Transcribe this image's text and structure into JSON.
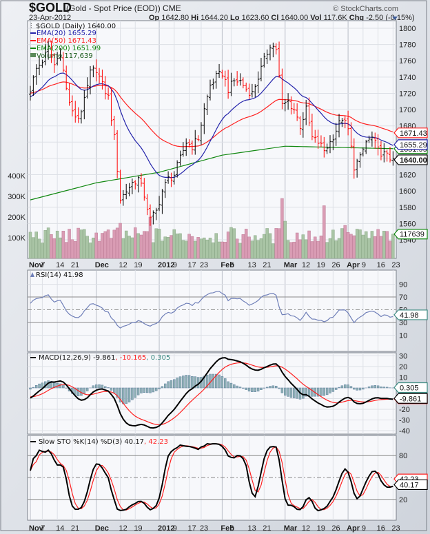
{
  "header": {
    "symbol": "$GOLD",
    "description": "(Gold - Spot Price (EOD)) CME",
    "copyright": "© StockCharts.com",
    "date": "23-Apr-2012",
    "quote": [
      {
        "label": "Op",
        "value": "1642.80"
      },
      {
        "label": "Hi",
        "value": "1644.20"
      },
      {
        "label": "Lo",
        "value": "1623.60"
      },
      {
        "label": "Cl",
        "value": "1640.00"
      },
      {
        "label": "Vol",
        "value": "117.6K"
      },
      {
        "label": "Chg",
        "value": "-2.50 (-0.15%)"
      }
    ]
  },
  "legend": {
    "price": "$GOLD (Daily) 1640.00",
    "ema20": "EMA(20) 1655.29",
    "ema50": "EMA(50) 1671.43",
    "ema200": "EMA(200) 1651.99",
    "volume": "Volume 117,639",
    "rsi": "RSI(14) 41.98",
    "macd_label": "MACD(12,26,9) -9.861",
    "macd_signal": ", -10.165",
    "macd_hist": ", 0.305",
    "sto_label": "Slow STO %K(14) %D(3) 40.17",
    "sto_d": ", 42.23"
  },
  "tags": {
    "ema50": "1671.43",
    "ema20": "1655.29",
    "ema200": "1651.99",
    "close": "1640.00",
    "volume": "117639",
    "rsi": "41.98",
    "macd_hist": "0.305",
    "macd_signal": "-10.165",
    "macd": "-9.861",
    "sto_d": "42.23",
    "sto_k": "40.17"
  },
  "colors": {
    "up": "#000000",
    "down": "#ff0000",
    "ema20": "#2222aa",
    "ema50": "#ff2020",
    "ema200": "#118811",
    "vol_up": "#a9c4a5",
    "vol_down": "#d99cb4",
    "rsi": "#6f7fb8",
    "hist": "#8fb0b4"
  },
  "chart_data": {
    "type": "line",
    "title": "$GOLD (Gold - Spot Price (EOD)) CME",
    "x_ticks": [
      {
        "i": 0,
        "label": "Nov",
        "bold": true
      },
      {
        "i": 4,
        "label": "7"
      },
      {
        "i": 9,
        "label": "14"
      },
      {
        "i": 14,
        "label": "21"
      },
      {
        "i": 22,
        "label": "Dec",
        "bold": true
      },
      {
        "i": 30,
        "label": "12"
      },
      {
        "i": 35,
        "label": "19"
      },
      {
        "i": 43,
        "label": "2012",
        "bold": true
      },
      {
        "i": 48,
        "label": "9"
      },
      {
        "i": 53,
        "label": "17"
      },
      {
        "i": 57,
        "label": "23"
      },
      {
        "i": 64,
        "label": "Feb",
        "bold": true
      },
      {
        "i": 67,
        "label": "6"
      },
      {
        "i": 73,
        "label": "13"
      },
      {
        "i": 78,
        "label": "21"
      },
      {
        "i": 85,
        "label": "Mar",
        "bold": true
      },
      {
        "i": 91,
        "label": "12"
      },
      {
        "i": 96,
        "label": "19"
      },
      {
        "i": 101,
        "label": "26"
      },
      {
        "i": 106,
        "label": "Apr",
        "bold": true
      },
      {
        "i": 111,
        "label": "9"
      },
      {
        "i": 116,
        "label": "16"
      },
      {
        "i": 121,
        "label": "23"
      }
    ],
    "price_axis": {
      "ticks": [
        1540,
        1560,
        1580,
        1600,
        1620,
        1640,
        1660,
        1680,
        1700,
        1720,
        1740,
        1760,
        1780,
        1800
      ],
      "range": [
        1540,
        1800
      ]
    },
    "volume_axis": {
      "ticks": [
        100,
        200,
        300,
        400
      ],
      "labels": [
        "100K",
        "200K",
        "300K",
        "400K"
      ]
    },
    "close_keypoints": [
      [
        0,
        1725
      ],
      [
        2,
        1750
      ],
      [
        4,
        1760
      ],
      [
        6,
        1775
      ],
      [
        8,
        1755
      ],
      [
        10,
        1770
      ],
      [
        12,
        1725
      ],
      [
        14,
        1695
      ],
      [
        16,
        1690
      ],
      [
        18,
        1710
      ],
      [
        20,
        1745
      ],
      [
        22,
        1750
      ],
      [
        24,
        1730
      ],
      [
        26,
        1715
      ],
      [
        28,
        1665
      ],
      [
        30,
        1590
      ],
      [
        32,
        1600
      ],
      [
        34,
        1610
      ],
      [
        36,
        1615
      ],
      [
        38,
        1595
      ],
      [
        40,
        1565
      ],
      [
        42,
        1575
      ],
      [
        44,
        1600
      ],
      [
        46,
        1615
      ],
      [
        48,
        1620
      ],
      [
        50,
        1640
      ],
      [
        52,
        1660
      ],
      [
        54,
        1655
      ],
      [
        56,
        1665
      ],
      [
        58,
        1700
      ],
      [
        60,
        1730
      ],
      [
        62,
        1740
      ],
      [
        64,
        1745
      ],
      [
        66,
        1725
      ],
      [
        68,
        1735
      ],
      [
        70,
        1735
      ],
      [
        72,
        1725
      ],
      [
        74,
        1720
      ],
      [
        76,
        1740
      ],
      [
        78,
        1760
      ],
      [
        80,
        1780
      ],
      [
        82,
        1775
      ],
      [
        84,
        1705
      ],
      [
        86,
        1710
      ],
      [
        88,
        1700
      ],
      [
        90,
        1680
      ],
      [
        92,
        1700
      ],
      [
        94,
        1665
      ],
      [
        96,
        1660
      ],
      [
        98,
        1650
      ],
      [
        100,
        1660
      ],
      [
        102,
        1675
      ],
      [
        104,
        1690
      ],
      [
        106,
        1675
      ],
      [
        108,
        1630
      ],
      [
        110,
        1640
      ],
      [
        112,
        1660
      ],
      [
        114,
        1665
      ],
      [
        116,
        1650
      ],
      [
        118,
        1645
      ],
      [
        120,
        1640
      ],
      [
        121,
        1640
      ]
    ],
    "ema200_keypoints": [
      [
        0,
        1589
      ],
      [
        22,
        1610
      ],
      [
        43,
        1623
      ],
      [
        64,
        1644
      ],
      [
        85,
        1655
      ],
      [
        121,
        1652
      ]
    ],
    "volume_spikes_k": [
      [
        30,
        170
      ],
      [
        40,
        200
      ],
      [
        84,
        290
      ],
      [
        85,
        180
      ],
      [
        98,
        255
      ],
      [
        105,
        160
      ]
    ],
    "rsi_axis": {
      "ticks": [
        10,
        30,
        50,
        70,
        90
      ]
    },
    "macd_axis": {
      "ticks": [
        -40,
        -30,
        -20,
        -10,
        0,
        10,
        20,
        30
      ]
    },
    "sto_axis": {
      "ticks": [
        20,
        50,
        80
      ]
    },
    "last": {
      "close": 1640.0,
      "ema20": 1655.29,
      "ema50": 1671.43,
      "ema200": 1651.99,
      "volume": 117639,
      "rsi": 41.98,
      "macd": -9.861,
      "signal": -10.165,
      "hist": 0.305,
      "sto_k": 40.17,
      "sto_d": 42.23
    }
  }
}
